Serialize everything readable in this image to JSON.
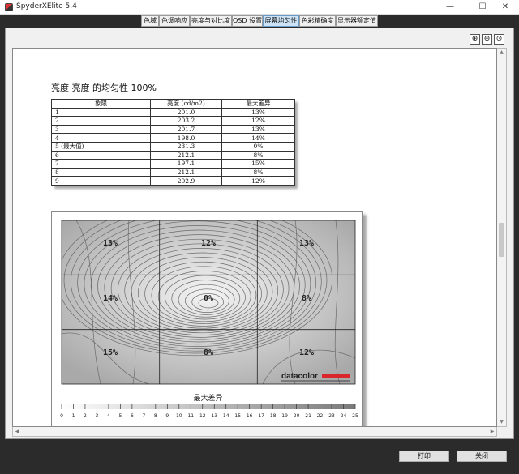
{
  "window": {
    "title": "SpyderXElite 5.4",
    "minimize_glyph": "—",
    "maximize_glyph": "☐",
    "close_glyph": "✕"
  },
  "tabs": [
    {
      "label": "色域",
      "active": false
    },
    {
      "label": "色调响应",
      "active": false
    },
    {
      "label": "亮度与对比度",
      "active": false
    },
    {
      "label": "OSD 设置",
      "active": false
    },
    {
      "label": "屏幕均匀性",
      "active": true
    },
    {
      "label": "色彩精确度",
      "active": false
    },
    {
      "label": "显示器额定值",
      "active": false
    }
  ],
  "toolbar": {
    "zoom_in_icon": "⊕",
    "zoom_out_icon": "⊖",
    "zoom_fit_icon": "⊙"
  },
  "report": {
    "title": "亮度 亮度 的均匀性 100%",
    "table": {
      "headers": [
        "象限",
        "亮度 (cd/m2)",
        "最大差异"
      ],
      "rows": [
        [
          "1",
          "201.0",
          "13%"
        ],
        [
          "2",
          "203.2",
          "12%"
        ],
        [
          "3",
          "201.7",
          "13%"
        ],
        [
          "4",
          "198.0",
          "14%"
        ],
        [
          "5 (最大值)",
          "231.3",
          "0%"
        ],
        [
          "6",
          "212.1",
          "8%"
        ],
        [
          "7",
          "197.1",
          "15%"
        ],
        [
          "8",
          "212.1",
          "8%"
        ],
        [
          "9",
          "202.9",
          "12%"
        ]
      ]
    },
    "map": {
      "cells": [
        "13%",
        "12%",
        "13%",
        "14%",
        "0%",
        "8%",
        "15%",
        "8%",
        "12%"
      ],
      "brand": "datacolor"
    },
    "legend": {
      "title": "最大差异",
      "ticks": [
        "0",
        "1",
        "2",
        "3",
        "4",
        "5",
        "6",
        "7",
        "8",
        "9",
        "10",
        "11",
        "12",
        "13",
        "14",
        "15",
        "16",
        "17",
        "18",
        "19",
        "20",
        "21",
        "22",
        "23",
        "24",
        "25"
      ]
    }
  },
  "buttons": {
    "print": "打印",
    "close": "关闭"
  },
  "colors": {
    "active_tab": "#cde3f6",
    "brand_red": "#d9262c"
  }
}
